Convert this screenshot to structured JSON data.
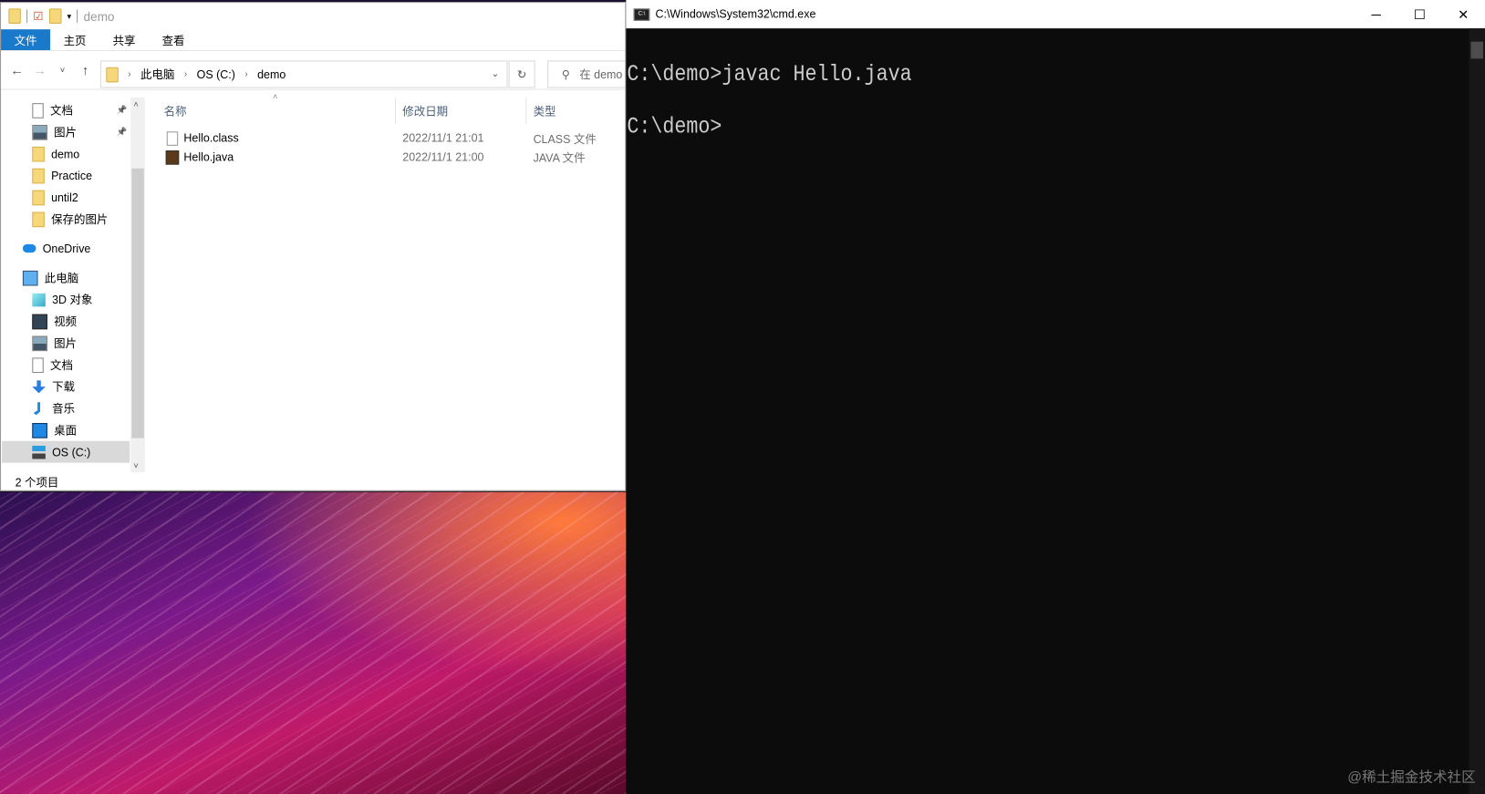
{
  "explorer": {
    "title": "demo",
    "ribbon_tabs": [
      "文件",
      "主页",
      "共享",
      "查看"
    ],
    "breadcrumb": [
      "此电脑",
      "OS (C:)",
      "demo"
    ],
    "search_placeholder": "在 demo",
    "sidebar": [
      {
        "label": "文档",
        "icon": "document-icon",
        "pinned": true
      },
      {
        "label": "图片",
        "icon": "pictures-icon",
        "pinned": true
      },
      {
        "label": "demo",
        "icon": "folder-icon"
      },
      {
        "label": "Practice",
        "icon": "folder-icon"
      },
      {
        "label": "until2",
        "icon": "folder-icon"
      },
      {
        "label": "保存的图片",
        "icon": "folder-icon"
      },
      {
        "label": "OneDrive",
        "icon": "onedrive-icon"
      },
      {
        "label": "此电脑",
        "icon": "computer-icon"
      },
      {
        "label": "3D 对象",
        "icon": "3d-objects-icon"
      },
      {
        "label": "视频",
        "icon": "videos-icon"
      },
      {
        "label": "图片",
        "icon": "pictures-icon"
      },
      {
        "label": "文档",
        "icon": "document-icon"
      },
      {
        "label": "下载",
        "icon": "download-icon"
      },
      {
        "label": "音乐",
        "icon": "music-icon"
      },
      {
        "label": "桌面",
        "icon": "desktop-icon"
      },
      {
        "label": "OS (C:)",
        "icon": "drive-icon",
        "selected": true
      }
    ],
    "columns": [
      "名称",
      "修改日期",
      "类型"
    ],
    "files": [
      {
        "name": "Hello.class",
        "modified": "2022/11/1 21:01",
        "type": "CLASS 文件"
      },
      {
        "name": "Hello.java",
        "modified": "2022/11/1 21:00",
        "type": "JAVA 文件"
      }
    ],
    "status": "2 个项目"
  },
  "cmd": {
    "title": "C:\\Windows\\System32\\cmd.exe",
    "icon_text": "C:\\",
    "lines": [
      "C:\\demo>javac Hello.java",
      "C:\\demo>"
    ]
  },
  "watermark": "@稀土掘金技术社区"
}
